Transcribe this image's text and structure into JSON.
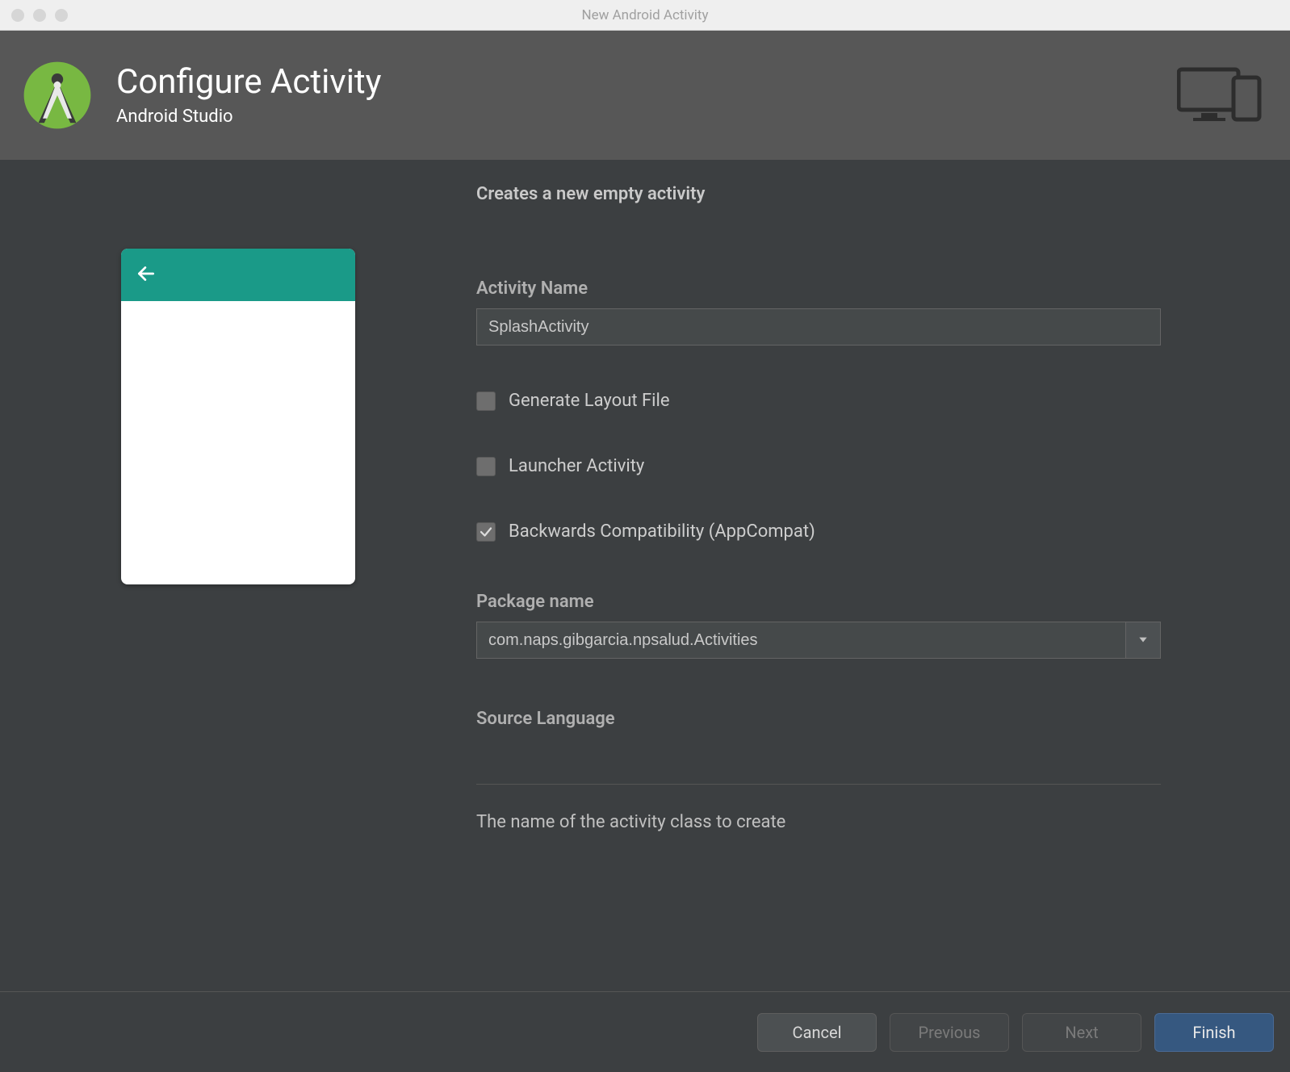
{
  "window": {
    "title": "New Android Activity"
  },
  "header": {
    "title": "Configure Activity",
    "subtitle": "Android Studio"
  },
  "form": {
    "heading": "Creates a new empty activity",
    "activity_name_label": "Activity Name",
    "activity_name_value": "SplashActivity",
    "generate_layout_label": "Generate Layout File",
    "generate_layout_checked": false,
    "launcher_activity_label": "Launcher Activity",
    "launcher_activity_checked": false,
    "backwards_compat_label": "Backwards Compatibility (AppCompat)",
    "backwards_compat_checked": true,
    "package_name_label": "Package name",
    "package_name_value": "com.naps.gibgarcia.npsalud.Activities",
    "source_language_label": "Source Language",
    "help_text": "The name of the activity class to create"
  },
  "buttons": {
    "cancel": "Cancel",
    "previous": "Previous",
    "next": "Next",
    "finish": "Finish"
  }
}
